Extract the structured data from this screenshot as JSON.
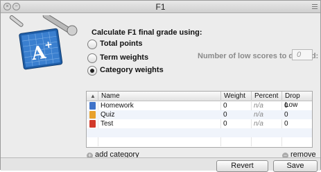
{
  "window": {
    "title": "F1"
  },
  "form": {
    "heading": "Calculate F1 final grade using:",
    "options": [
      {
        "label": "Total points",
        "selected": false
      },
      {
        "label": "Term weights",
        "selected": false
      },
      {
        "label": "Category weights",
        "selected": true
      }
    ],
    "low_scores_label": "Number of low scores to discard:",
    "low_scores_value": "0"
  },
  "table": {
    "sort_indicator": "▲",
    "columns": [
      "Name",
      "Weight",
      "Percent",
      "Drop Low"
    ],
    "rows": [
      {
        "icon": "blue-book-icon",
        "color": "#3f73c9",
        "name": "Homework",
        "weight": "0",
        "percent": "n/a",
        "drop_low": "0"
      },
      {
        "icon": "orange-book-icon",
        "color": "#e8a12c",
        "name": "Quiz",
        "weight": "0",
        "percent": "n/a",
        "drop_low": "0"
      },
      {
        "icon": "red-book-icon",
        "color": "#d23a2a",
        "name": "Test",
        "weight": "0",
        "percent": "n/a",
        "drop_low": "0"
      }
    ]
  },
  "actions": {
    "add_icon": "+",
    "add_label": "add category",
    "remove_icon": "−",
    "remove_label": "remove"
  },
  "footer": {
    "revert_label": "Revert",
    "save_label": "Save"
  }
}
